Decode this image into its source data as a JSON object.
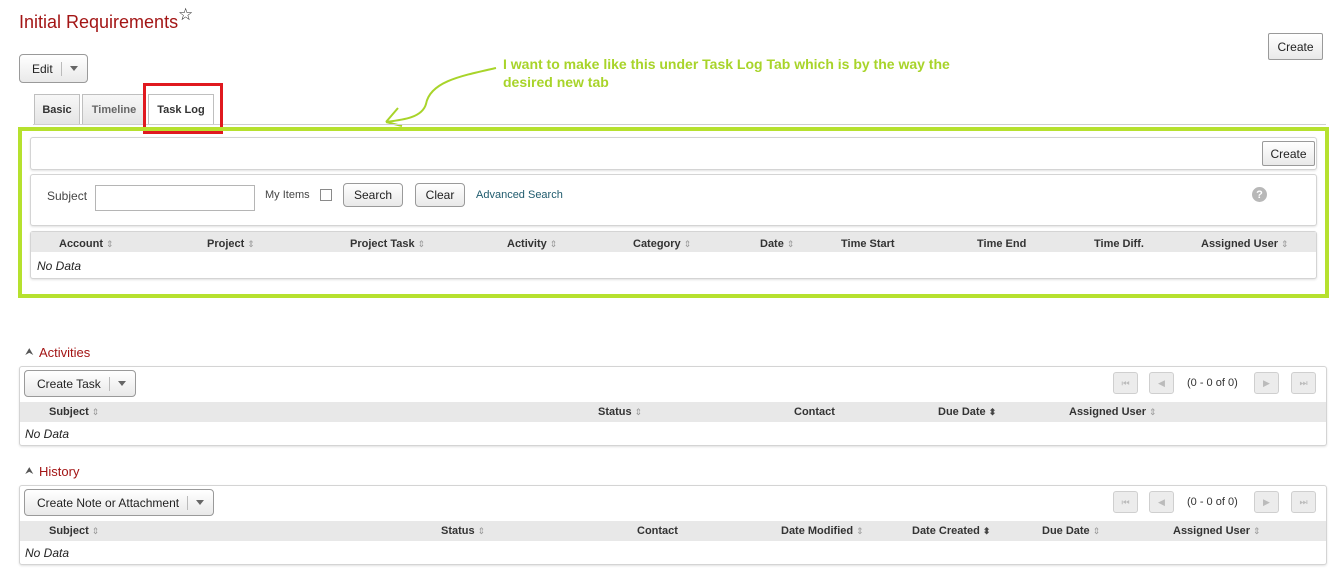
{
  "title": "Initial Requirements",
  "header": {
    "create_label": "Create",
    "edit_label": "Edit"
  },
  "tabs": [
    "Basic",
    "Timeline",
    "Task Log"
  ],
  "annotation": "I want to make like this under Task Log Tab which is by the way the desired new tab",
  "tasklog": {
    "create_label": "Create",
    "search": {
      "subject_label": "Subject",
      "subject_value": "",
      "my_items_label": "My Items",
      "search_label": "Search",
      "clear_label": "Clear",
      "advanced_label": "Advanced Search",
      "help_label": "?"
    },
    "columns": [
      "Account",
      "Project",
      "Project Task",
      "Activity",
      "Category",
      "Date",
      "Time Start",
      "Time End",
      "Time Diff.",
      "Assigned User"
    ],
    "empty": "No Data"
  },
  "activities": {
    "title": "Activities",
    "create_label": "Create Task",
    "pager": "(0 - 0 of 0)",
    "columns": [
      "Subject",
      "Status",
      "Contact",
      "Due Date",
      "Assigned User"
    ],
    "empty": "No Data"
  },
  "history": {
    "title": "History",
    "create_label": "Create Note or Attachment",
    "pager": "(0 - 0 of 0)",
    "columns": [
      "Subject",
      "Status",
      "Contact",
      "Date Modified",
      "Date Created",
      "Due Date",
      "Assigned User"
    ],
    "empty": "No Data"
  },
  "colors": {
    "title_red": "#a31515",
    "annotation_green": "#b6e12e",
    "highlight_red": "#e0191f"
  }
}
